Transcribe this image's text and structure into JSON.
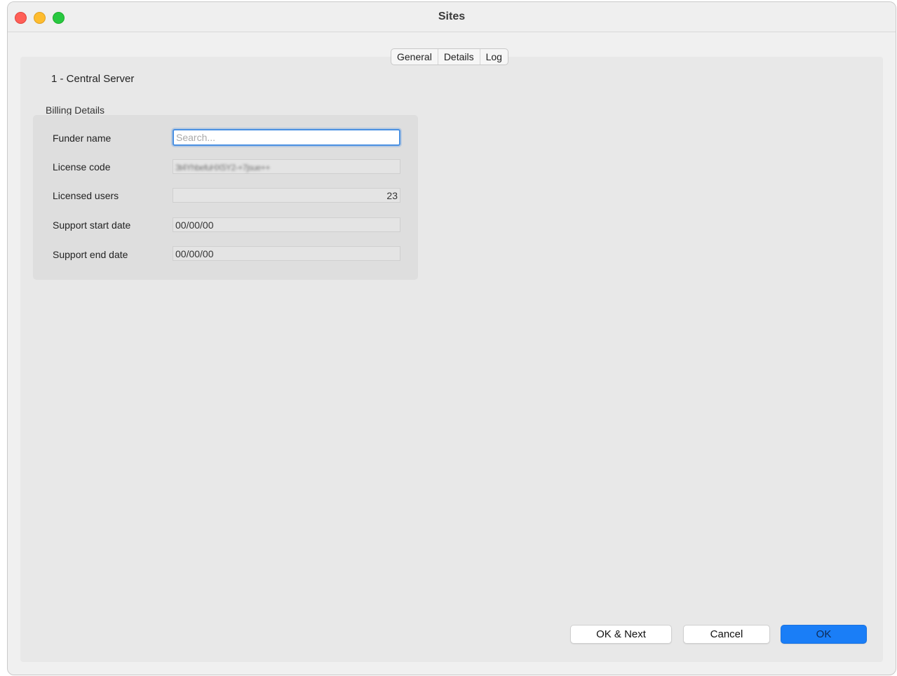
{
  "window": {
    "title": "Sites"
  },
  "tabs": [
    {
      "label": "General"
    },
    {
      "label": "Details"
    },
    {
      "label": "Log"
    }
  ],
  "site": {
    "name": "1 - Central Server"
  },
  "billing": {
    "group_label": "Billing Details",
    "funder_name": {
      "label": "Funder name",
      "placeholder": "Search...",
      "value": ""
    },
    "license_code": {
      "label": "License code",
      "value": "3t4YhbefuHX5Y2-+7jsue++"
    },
    "licensed_users": {
      "label": "Licensed users",
      "value": "23"
    },
    "support_start_date": {
      "label": "Support start date",
      "value": "00/00/00"
    },
    "support_end_date": {
      "label": "Support end date",
      "value": "00/00/00"
    }
  },
  "buttons": {
    "ok_next": "OK & Next",
    "cancel": "Cancel",
    "ok": "OK"
  },
  "colors": {
    "accent": "#1a7ef7",
    "close": "#ff5f57",
    "minimize": "#febc2e",
    "maximize": "#28c840"
  }
}
